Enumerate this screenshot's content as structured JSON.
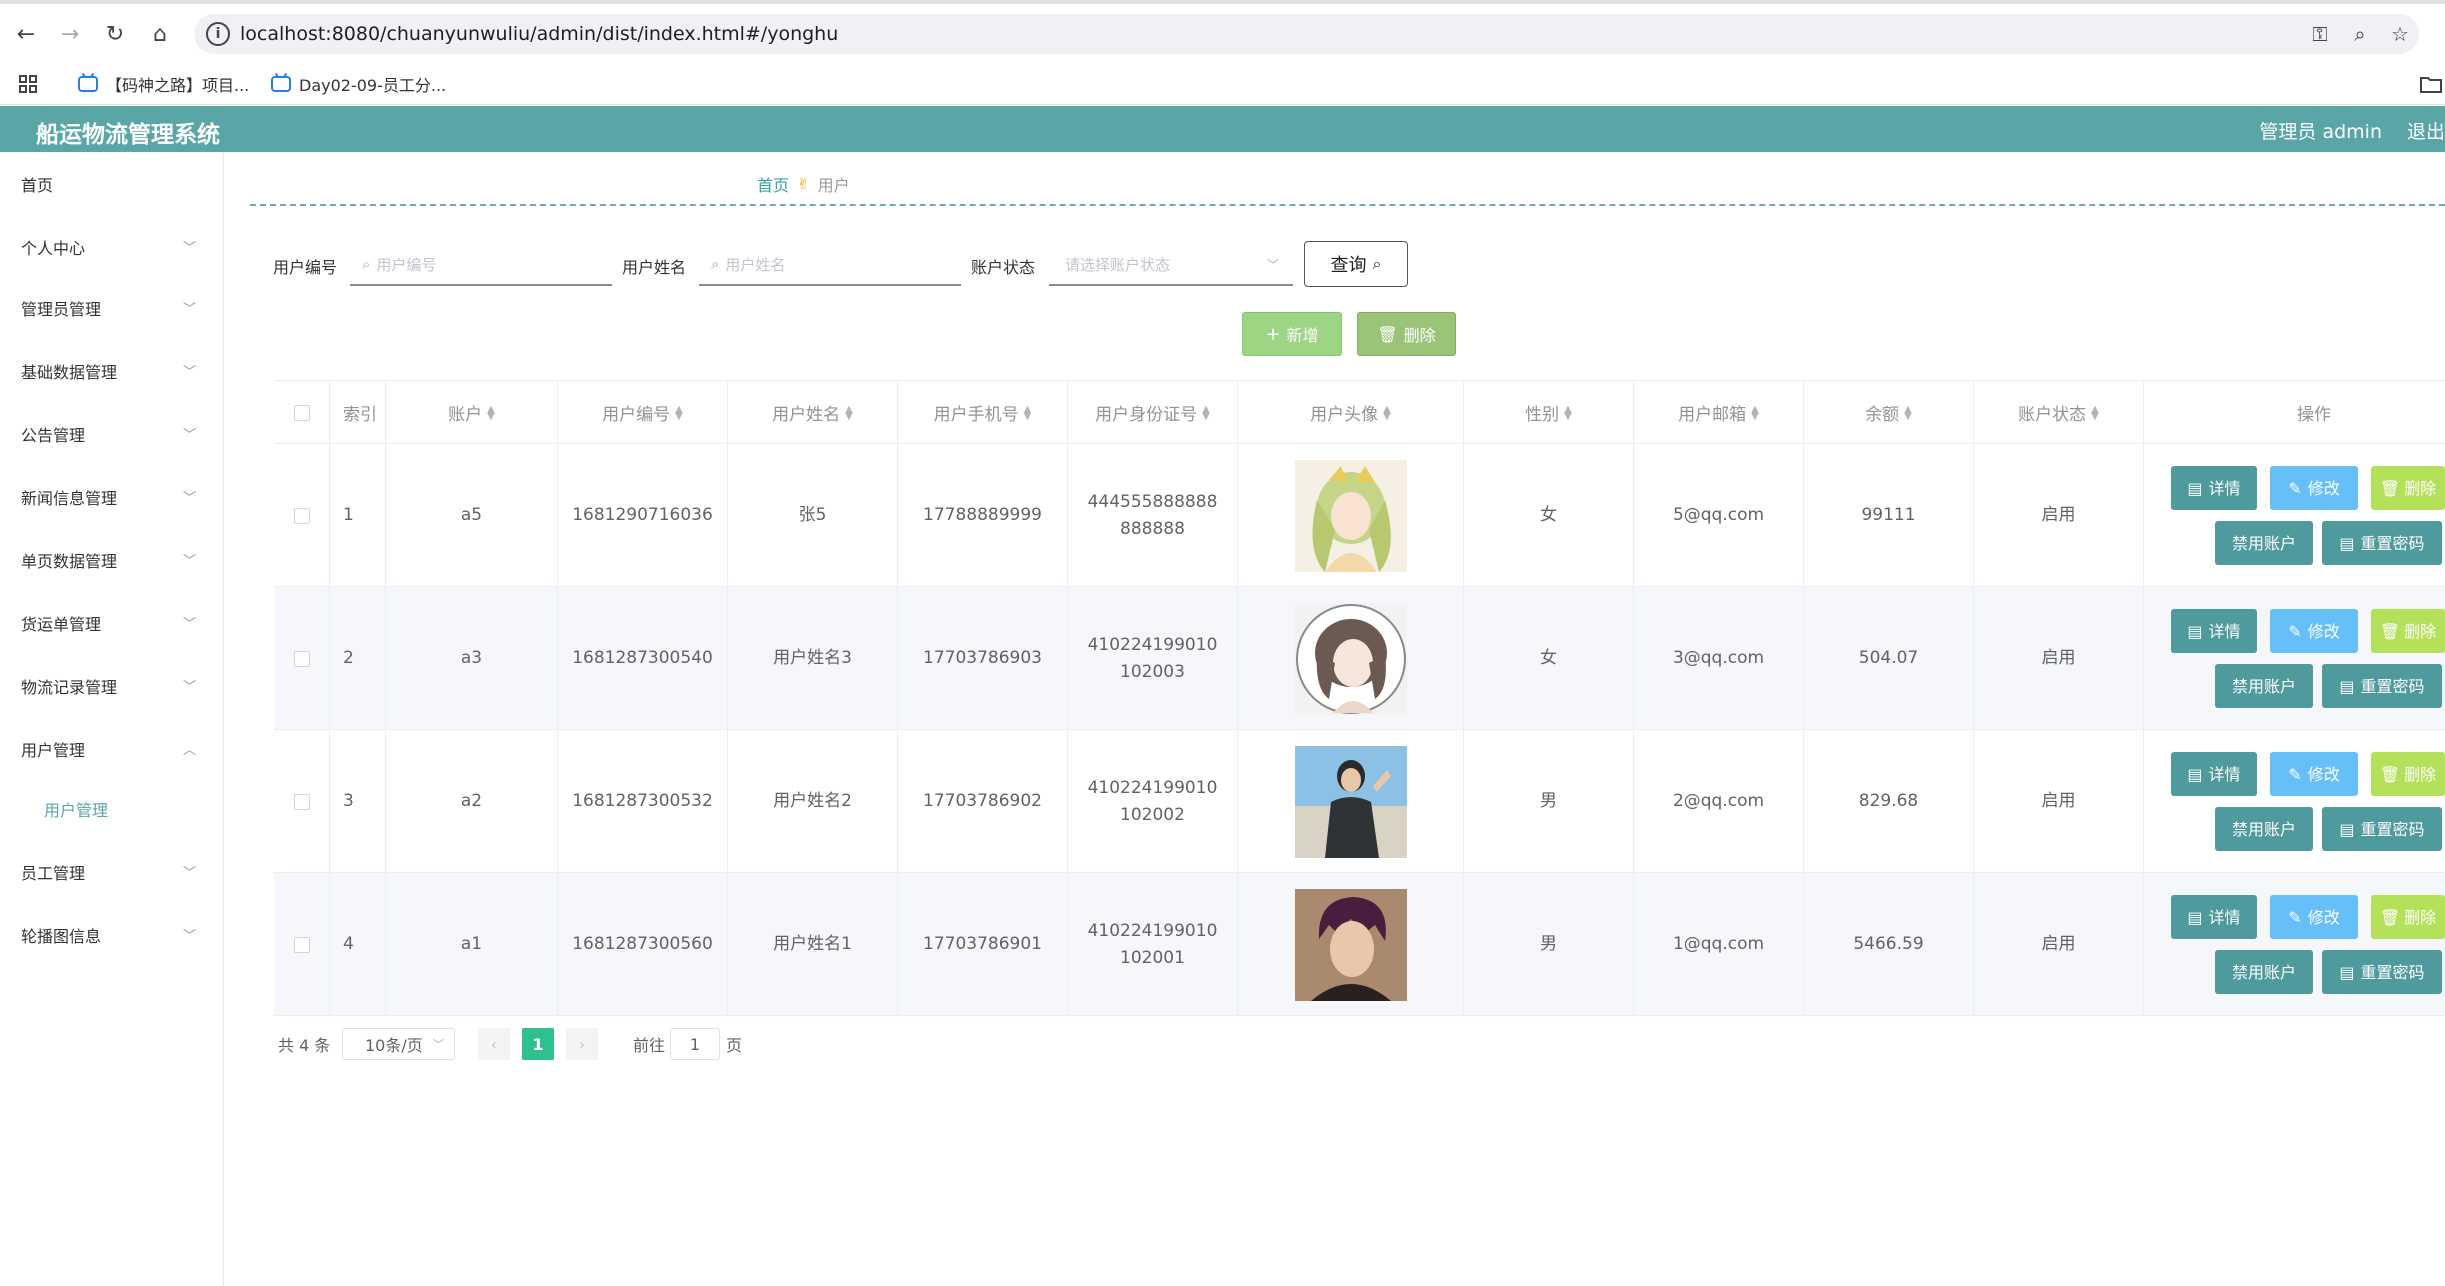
{
  "browser": {
    "url": "localhost:8080/chuanyunwuliu/admin/dist/index.html#/yonghu",
    "bookmarks": [
      "【码神之路】项目...",
      "Day02-09-员工分..."
    ]
  },
  "header": {
    "title": "船运物流管理系统",
    "admin_label": "管理员 admin",
    "logout": "退出"
  },
  "sidebar": {
    "items": [
      {
        "label": "首页"
      },
      {
        "label": "个人中心"
      },
      {
        "label": "管理员管理"
      },
      {
        "label": "基础数据管理"
      },
      {
        "label": "公告管理"
      },
      {
        "label": "新闻信息管理"
      },
      {
        "label": "单页数据管理"
      },
      {
        "label": "货运单管理"
      },
      {
        "label": "物流记录管理"
      },
      {
        "label": "用户管理"
      },
      {
        "label": "员工管理"
      },
      {
        "label": "轮播图信息"
      }
    ],
    "sub_item": "用户管理"
  },
  "breadcrumb": {
    "home": "首页",
    "current": "用户"
  },
  "filters": {
    "user_no_label": "用户编号",
    "user_no_placeholder": "用户编号",
    "user_name_label": "用户姓名",
    "user_name_placeholder": "用户姓名",
    "status_label": "账户状态",
    "status_placeholder": "请选择账户状态",
    "query_button": "查询"
  },
  "actions": {
    "add": "新增",
    "delete": "删除"
  },
  "table": {
    "columns": [
      "索引",
      "账户",
      "用户编号",
      "用户姓名",
      "用户手机号",
      "用户身份证号",
      "用户头像",
      "性别",
      "用户邮箱",
      "余额",
      "账户状态",
      "操作"
    ],
    "rows": [
      {
        "index": "1",
        "account": "a5",
        "user_no": "1681290716036",
        "name": "张5",
        "phone": "17788889999",
        "id_card": "444555888888888888",
        "gender": "女",
        "email": "5@qq.com",
        "balance": "99111",
        "status": "启用"
      },
      {
        "index": "2",
        "account": "a3",
        "user_no": "1681287300540",
        "name": "用户姓名3",
        "phone": "17703786903",
        "id_card": "410224199010102003",
        "gender": "女",
        "email": "3@qq.com",
        "balance": "504.07",
        "status": "启用"
      },
      {
        "index": "3",
        "account": "a2",
        "user_no": "1681287300532",
        "name": "用户姓名2",
        "phone": "17703786902",
        "id_card": "410224199010102002",
        "gender": "男",
        "email": "2@qq.com",
        "balance": "829.68",
        "status": "启用"
      },
      {
        "index": "4",
        "account": "a1",
        "user_no": "1681287300560",
        "name": "用户姓名1",
        "phone": "17703786901",
        "id_card": "410224199010102001",
        "gender": "男",
        "email": "1@qq.com",
        "balance": "5466.59",
        "status": "启用"
      }
    ],
    "op_labels": {
      "detail": "详情",
      "edit": "修改",
      "delete": "删除",
      "disable": "禁用账户",
      "reset": "重置密码"
    }
  },
  "pagination": {
    "total": "共 4 条",
    "page_size": "10条/页",
    "current": "1",
    "goto_label": "前往",
    "goto_value": "1",
    "page_suffix": "页"
  }
}
